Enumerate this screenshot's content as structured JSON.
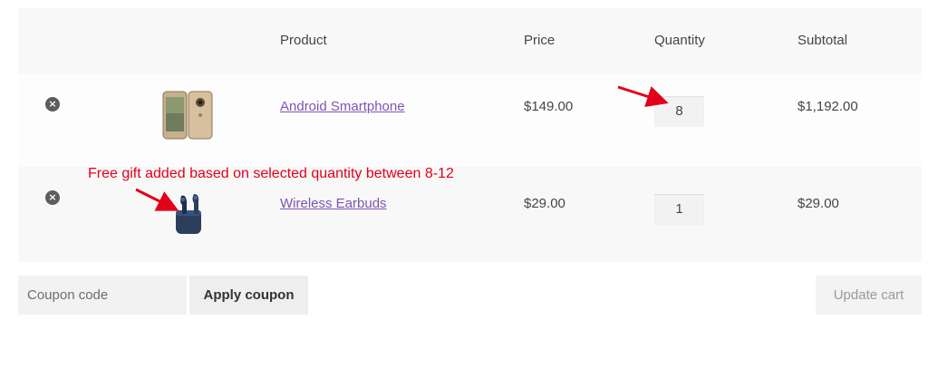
{
  "table": {
    "headers": {
      "product": "Product",
      "price": "Price",
      "quantity": "Quantity",
      "subtotal": "Subtotal"
    },
    "items": [
      {
        "name": "Android Smartphone",
        "price": "$149.00",
        "quantity": "8",
        "subtotal": "$1,192.00",
        "remove_symbol": "×",
        "thumbnail": "smartphone-image"
      },
      {
        "name": "Wireless Earbuds",
        "price": "$29.00",
        "quantity": "1",
        "subtotal": "$29.00",
        "remove_symbol": "×",
        "thumbnail": "earbuds-image"
      }
    ]
  },
  "annotation": {
    "text": "Free gift added based on selected quantity between 8-12",
    "color": "#e2001a"
  },
  "coupon": {
    "placeholder": "Coupon code",
    "apply_label": "Apply coupon"
  },
  "update_label": "Update cart",
  "colors": {
    "link": "#7f54b3",
    "header_bg": "#f8f8f8",
    "annotation": "#e2001a"
  }
}
